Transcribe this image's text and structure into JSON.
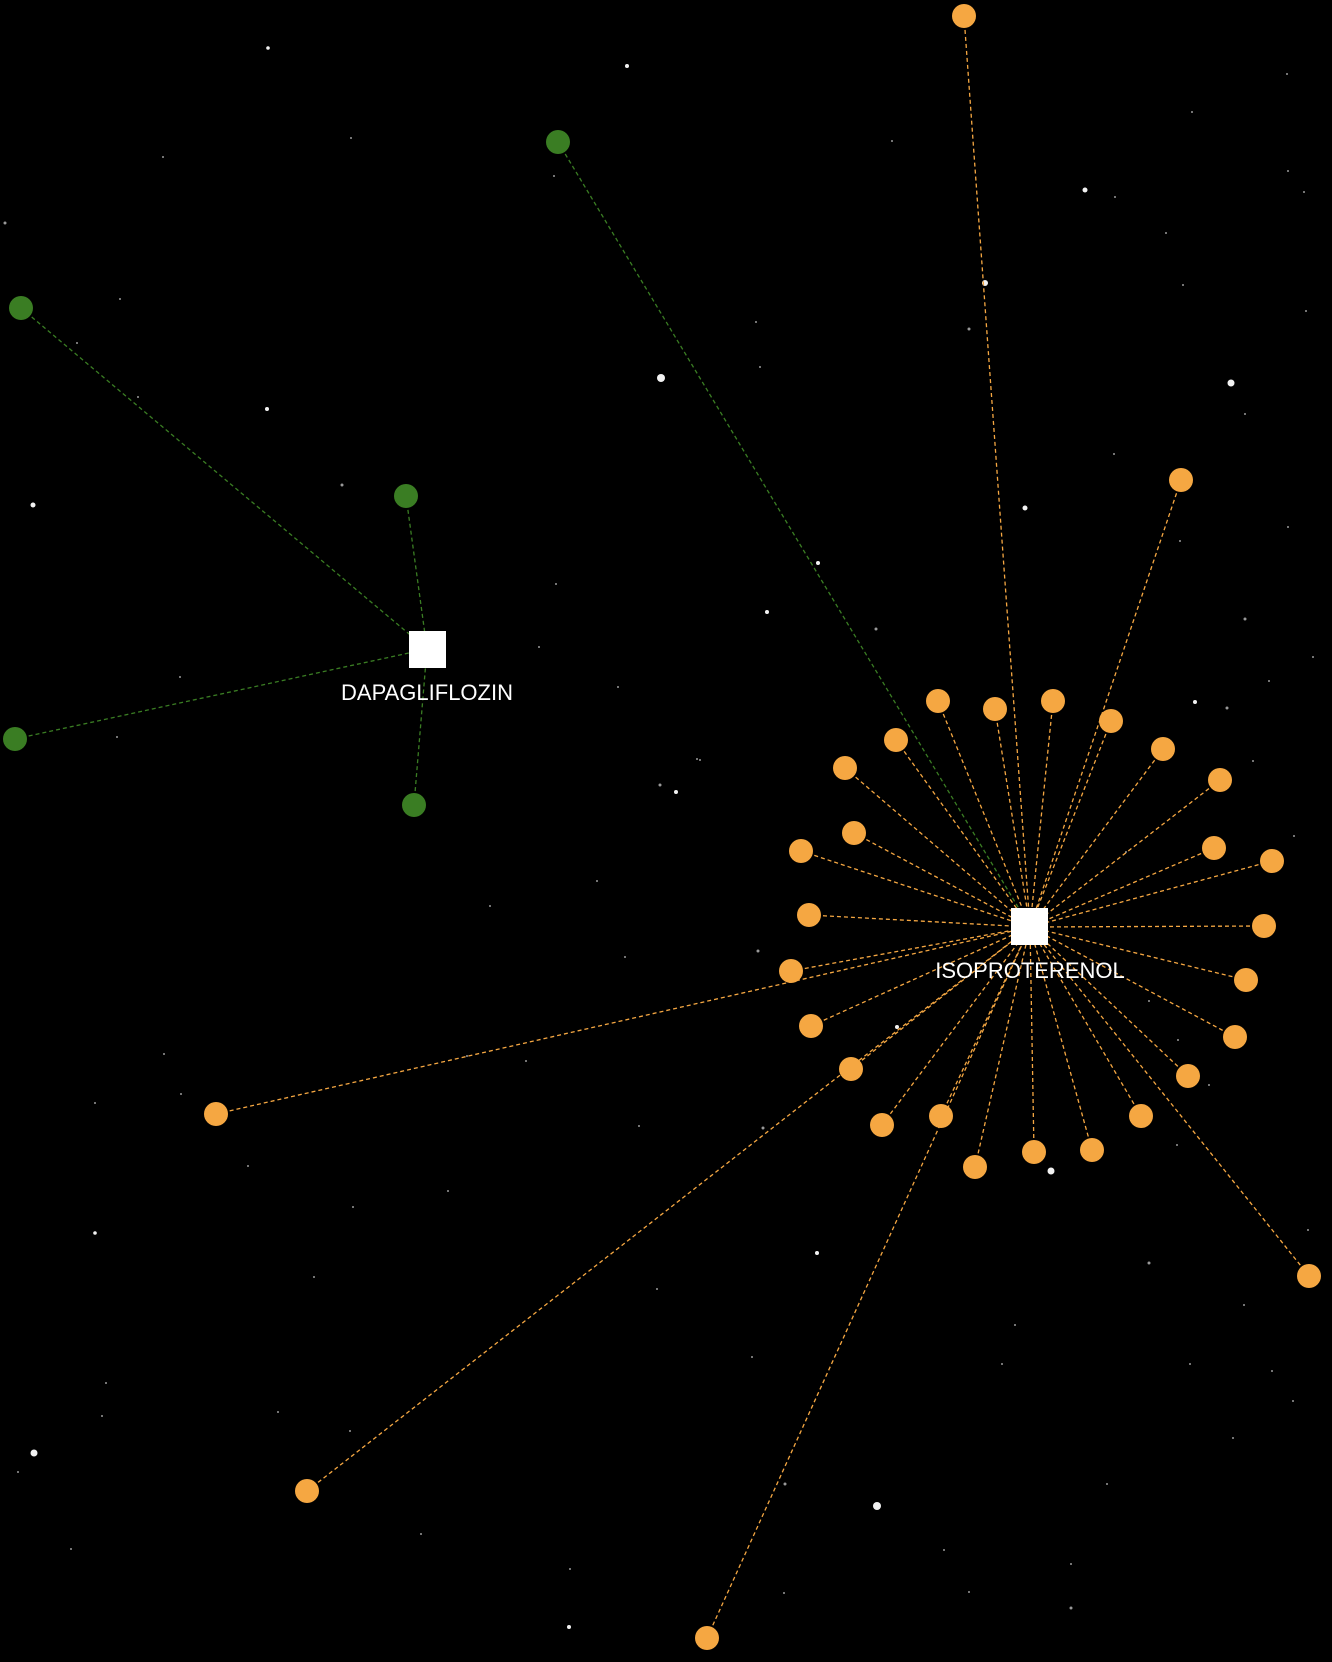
{
  "colors": {
    "background": "#000000",
    "hub_fill": "#ffffff",
    "hub_label": "#ffffff",
    "green_node": "#3a7d23",
    "green_edge": "#3a7d23",
    "orange_node": "#f5a742",
    "orange_edge": "#f5a742",
    "star": "#ffffff"
  },
  "hubs": [
    {
      "id": "dapagliflozin",
      "label": "DAPAGLIFLOZIN",
      "color_group": "green"
    },
    {
      "id": "isoproterenol",
      "label": "ISOPROTERENOL",
      "color_group": "orange"
    }
  ]
}
